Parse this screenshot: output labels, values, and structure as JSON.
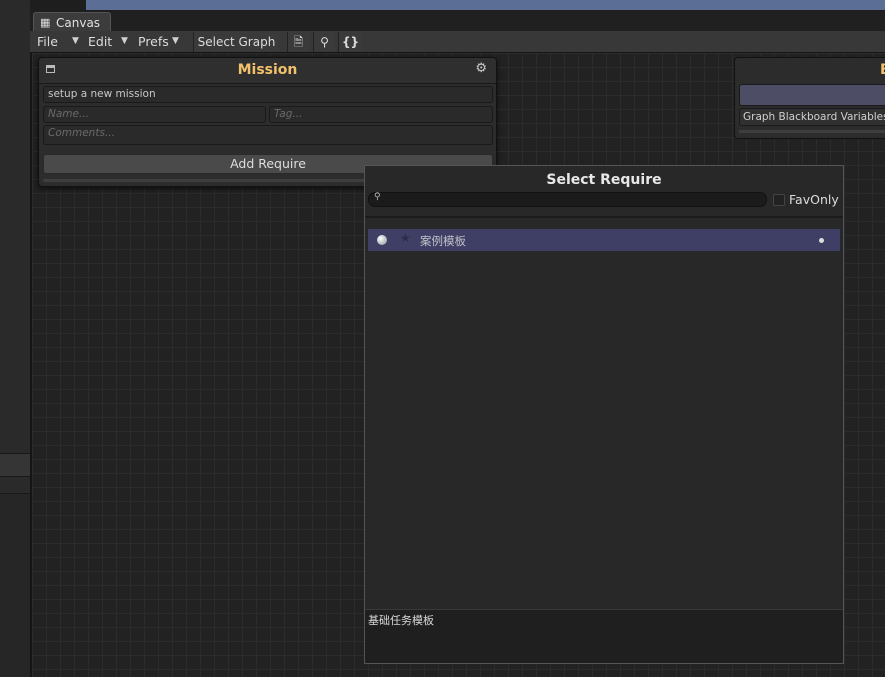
{
  "window": {
    "tab_title": "Canvas"
  },
  "menubar": {
    "file": "File",
    "edit": "Edit",
    "prefs": "Prefs",
    "select_graph": "Select Graph",
    "icons": [
      "document-icon",
      "search-icon",
      "braces-icon"
    ],
    "braces_glyph": "{}"
  },
  "mission_node": {
    "title": "Mission",
    "description": "setup a new mission",
    "name_placeholder": "Name...",
    "tag_placeholder": "Tag...",
    "comments_placeholder": "Comments...",
    "add_require": "Add Require"
  },
  "blackboard_node": {
    "title": "B",
    "variables_label": "Graph Blackboard Variables"
  },
  "select_popup": {
    "title": "Select Require",
    "search_value": "",
    "fav_only_label": "FavOnly",
    "fav_only_checked": false,
    "items": [
      {
        "label": "案例模板",
        "selected": true
      }
    ],
    "description": "基础任务模板"
  },
  "colors": {
    "node_title": "#f3c06b",
    "selected_row": "#3f3f66",
    "background": "#222222"
  }
}
